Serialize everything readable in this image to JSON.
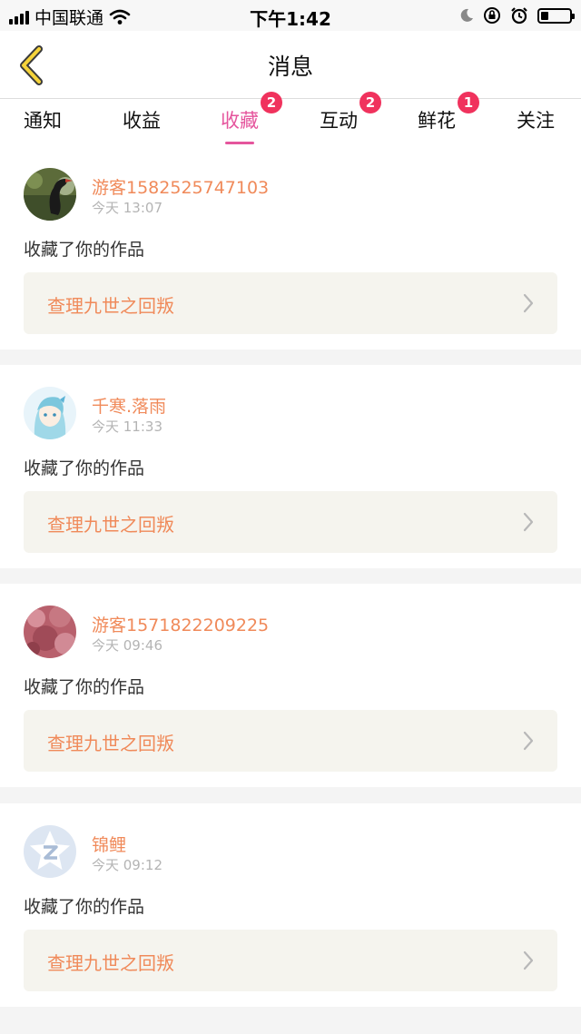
{
  "status_bar": {
    "carrier": "中国联通",
    "time": "下午1:42",
    "icons": [
      "signal-icon",
      "wifi-icon",
      "moon-icon",
      "rotation-lock-icon",
      "alarm-icon",
      "battery-icon"
    ]
  },
  "nav": {
    "title": "消息",
    "back_icon": "chevron-left-icon"
  },
  "colors": {
    "accent_pink": "#e5559d",
    "badge_red": "#f0325d",
    "name_orange": "#f08a5a",
    "work_bg": "#f5f4ee"
  },
  "tabs": [
    {
      "label": "通知",
      "badge": ""
    },
    {
      "label": "收益",
      "badge": ""
    },
    {
      "label": "收藏",
      "badge": "2",
      "active": true
    },
    {
      "label": "互动",
      "badge": "2"
    },
    {
      "label": "鲜花",
      "badge": "1"
    },
    {
      "label": "关注",
      "badge": ""
    }
  ],
  "messages": [
    {
      "user": "游客1582525747103",
      "time": "今天 13:07",
      "text": "收藏了你的作品",
      "work_title": "查理九世之回叛",
      "avatar": "bird-photo-avatar"
    },
    {
      "user": "千寒.落雨",
      "time": "今天 11:33",
      "text": "收藏了你的作品",
      "work_title": "查理九世之回叛",
      "avatar": "anime-girl-avatar"
    },
    {
      "user": "游客1571822209225",
      "time": "今天 09:46",
      "text": "收藏了你的作品",
      "work_title": "查理九世之回叛",
      "avatar": "pink-blossom-avatar"
    },
    {
      "user": "锦鲤",
      "time": "今天 09:12",
      "text": "收藏了你的作品",
      "work_title": "查理九世之回叛",
      "avatar": "default-star-avatar"
    }
  ]
}
